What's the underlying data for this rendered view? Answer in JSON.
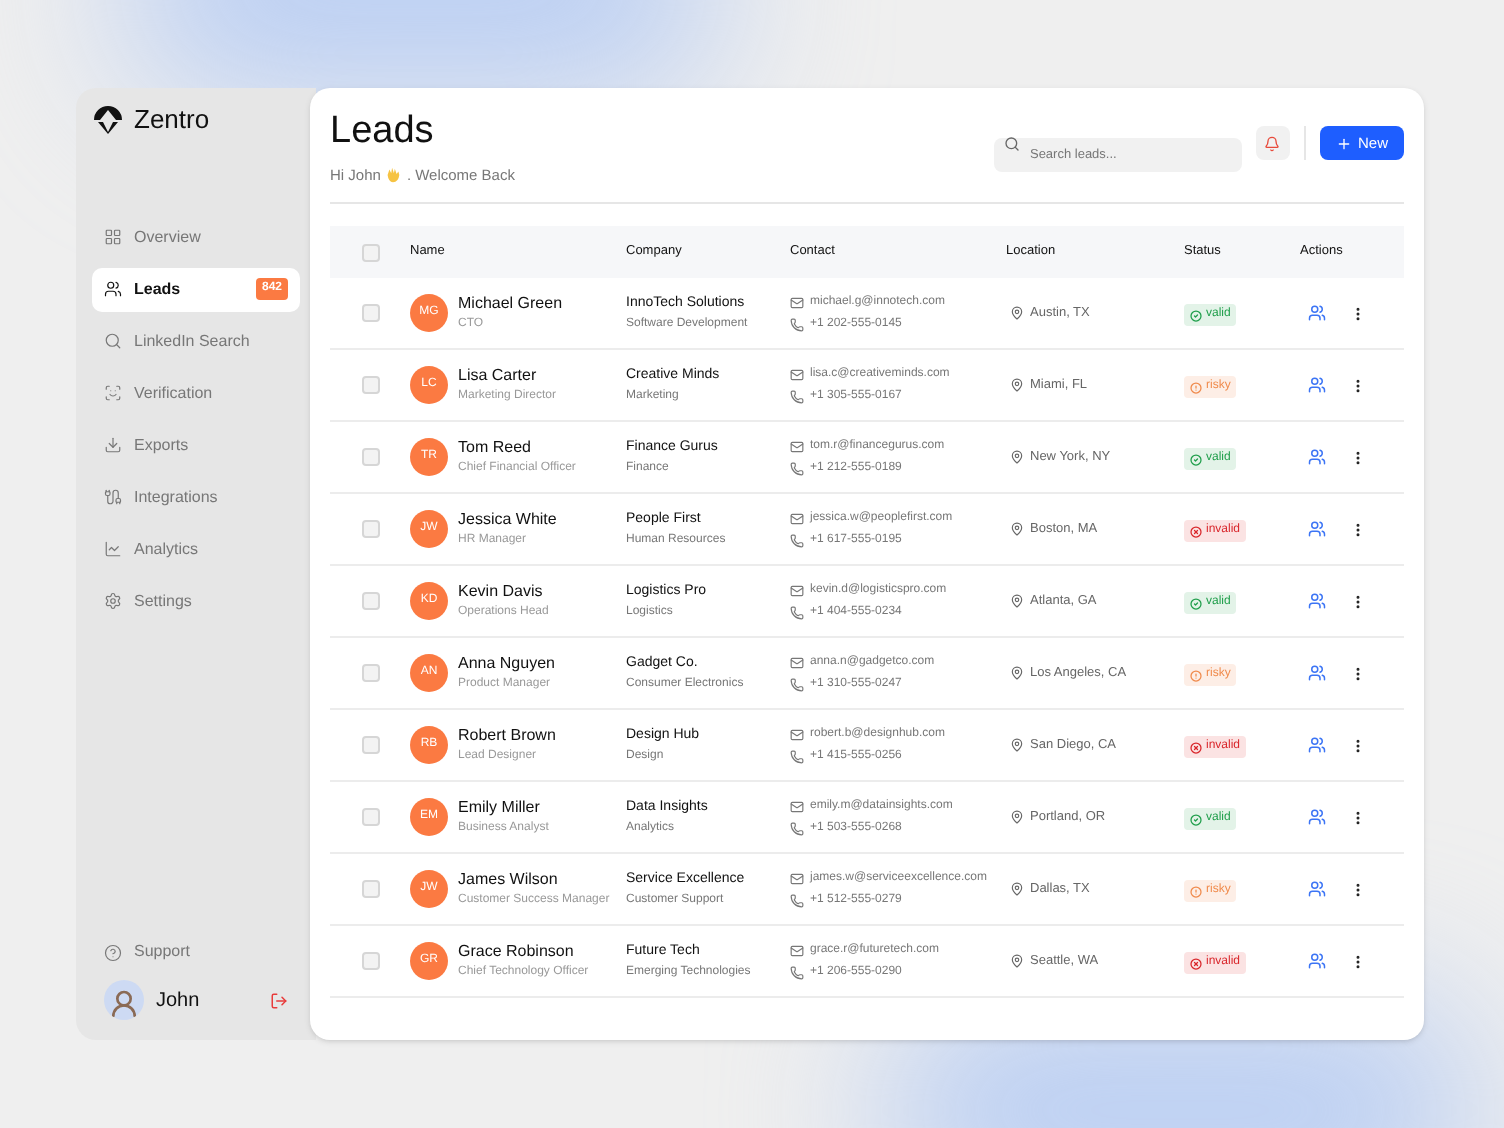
{
  "brand": {
    "name": "Zentro"
  },
  "sidebar": {
    "items": [
      {
        "label": "Overview",
        "selected": false
      },
      {
        "label": "Leads",
        "selected": true,
        "badge": "842"
      },
      {
        "label": "LinkedIn Search",
        "selected": false
      },
      {
        "label": "Verification",
        "selected": false
      },
      {
        "label": "Exports",
        "selected": false
      },
      {
        "label": "Integrations",
        "selected": false
      },
      {
        "label": "Analytics",
        "selected": false
      },
      {
        "label": "Settings",
        "selected": false
      }
    ],
    "support": "Support",
    "user": {
      "name": "John"
    }
  },
  "header": {
    "title": "Leads",
    "greeting": "Hi John",
    "greeting_rest": ". Welcome Back",
    "search": {
      "placeholder": "Search leads..."
    },
    "new_button": "New"
  },
  "table": {
    "header_checked": false,
    "columns": [
      "Name",
      "Company",
      "Contact",
      "Location",
      "Status",
      "Actions"
    ],
    "rows": [
      {
        "checked": false,
        "initials": "MG",
        "name": "Michael Green",
        "title": "CTO",
        "company": "InnoTech Solutions",
        "industry": "Software Development",
        "email": "michael.g@innotech.com",
        "phone": "+1 202-555-0145",
        "location": "Austin, TX",
        "status": {
          "kind": "valid",
          "label": "valid"
        }
      },
      {
        "checked": false,
        "initials": "LC",
        "name": "Lisa Carter",
        "title": "Marketing Director",
        "company": "Creative Minds",
        "industry": "Marketing",
        "email": "lisa.c@creativeminds.com",
        "phone": "+1 305-555-0167",
        "location": "Miami, FL",
        "status": {
          "kind": "risky",
          "label": "risky"
        }
      },
      {
        "checked": false,
        "initials": "TR",
        "name": "Tom Reed",
        "title": "Chief Financial Officer",
        "company": "Finance Gurus",
        "industry": "Finance",
        "email": "tom.r@financegurus.com",
        "phone": "+1 212-555-0189",
        "location": "New York, NY",
        "status": {
          "kind": "valid",
          "label": "valid"
        }
      },
      {
        "checked": false,
        "initials": "JW",
        "name": "Jessica White",
        "title": "HR Manager",
        "company": "People First",
        "industry": "Human Resources",
        "email": "jessica.w@peoplefirst.com",
        "phone": "+1 617-555-0195",
        "location": "Boston, MA",
        "status": {
          "kind": "invalid",
          "label": "invalid"
        }
      },
      {
        "checked": false,
        "initials": "KD",
        "name": "Kevin Davis",
        "title": "Operations Head",
        "company": "Logistics Pro",
        "industry": "Logistics",
        "email": "kevin.d@logisticspro.com",
        "phone": "+1 404-555-0234",
        "location": "Atlanta, GA",
        "status": {
          "kind": "valid",
          "label": "valid"
        }
      },
      {
        "checked": false,
        "initials": "AN",
        "name": "Anna Nguyen",
        "title": "Product Manager",
        "company": "Gadget Co.",
        "industry": "Consumer Electronics",
        "email": "anna.n@gadgetco.com",
        "phone": "+1 310-555-0247",
        "location": "Los Angeles, CA",
        "status": {
          "kind": "risky",
          "label": "risky"
        }
      },
      {
        "checked": false,
        "initials": "RB",
        "name": "Robert Brown",
        "title": "Lead Designer",
        "company": "Design Hub",
        "industry": "Design",
        "email": "robert.b@designhub.com",
        "phone": "+1 415-555-0256",
        "location": "San Diego, CA",
        "status": {
          "kind": "invalid",
          "label": "invalid"
        }
      },
      {
        "checked": false,
        "initials": "EM",
        "name": "Emily Miller",
        "title": "Business Analyst",
        "company": "Data Insights",
        "industry": "Analytics",
        "email": "emily.m@datainsights.com",
        "phone": "+1 503-555-0268",
        "location": "Portland, OR",
        "status": {
          "kind": "valid",
          "label": "valid"
        }
      },
      {
        "checked": false,
        "initials": "JW",
        "name": "James Wilson",
        "title": "Customer Success Manager",
        "company": "Service Excellence",
        "industry": "Customer Support",
        "email": "james.w@serviceexcellence.com",
        "phone": "+1 512-555-0279",
        "location": "Dallas, TX",
        "status": {
          "kind": "risky",
          "label": "risky"
        }
      },
      {
        "checked": false,
        "initials": "GR",
        "name": "Grace Robinson",
        "title": "Chief Technology Officer",
        "company": "Future Tech",
        "industry": "Emerging Technologies",
        "email": "grace.r@futuretech.com",
        "phone": "+1 206-555-0290",
        "location": "Seattle, WA",
        "status": {
          "kind": "invalid",
          "label": "invalid"
        }
      }
    ]
  }
}
